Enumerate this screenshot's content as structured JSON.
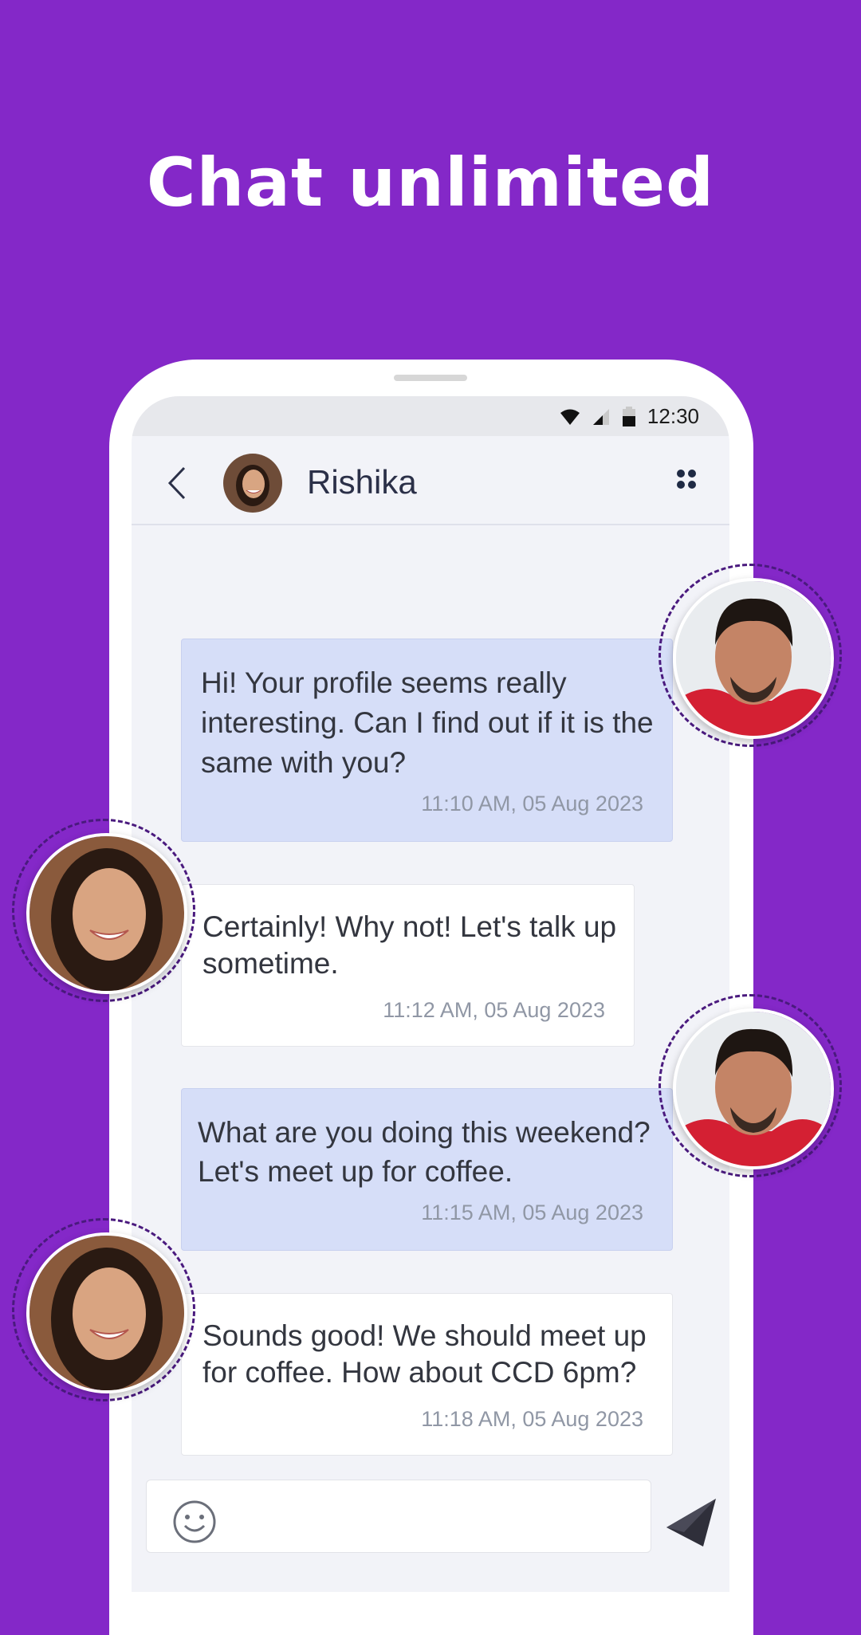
{
  "headline": "Chat unlimited",
  "status_bar": {
    "time": "12:30"
  },
  "chat_header": {
    "contact_name": "Rishika"
  },
  "messages": [
    {
      "direction": "sent",
      "text": "Hi! Your profile seems really interesting. Can I find out if it is the same with you?",
      "timestamp": "11:10 AM, 05 Aug 2023"
    },
    {
      "direction": "received",
      "text": "Certainly! Why not! Let's talk up sometime.",
      "timestamp": "11:12 AM, 05 Aug 2023"
    },
    {
      "direction": "sent",
      "text": "What are you doing this weekend? Let's meet up for coffee.",
      "timestamp": "11:15 AM, 05 Aug 2023"
    },
    {
      "direction": "received",
      "text": "Sounds good! We should meet up for coffee. How about CCD 6pm?",
      "timestamp": "11:18 AM, 05 Aug 2023"
    }
  ],
  "colors": {
    "background": "#8428c8",
    "sent_bubble": "#d6def8",
    "received_bubble": "#ffffff",
    "avatar_ring": "#4a1a7e"
  },
  "icons": {
    "back": "chevron-left-icon",
    "menu": "four-dots-icon",
    "emoji": "smiley-icon",
    "send": "paper-plane-icon",
    "status": [
      "wifi-icon",
      "signal-icon",
      "battery-icon"
    ]
  }
}
